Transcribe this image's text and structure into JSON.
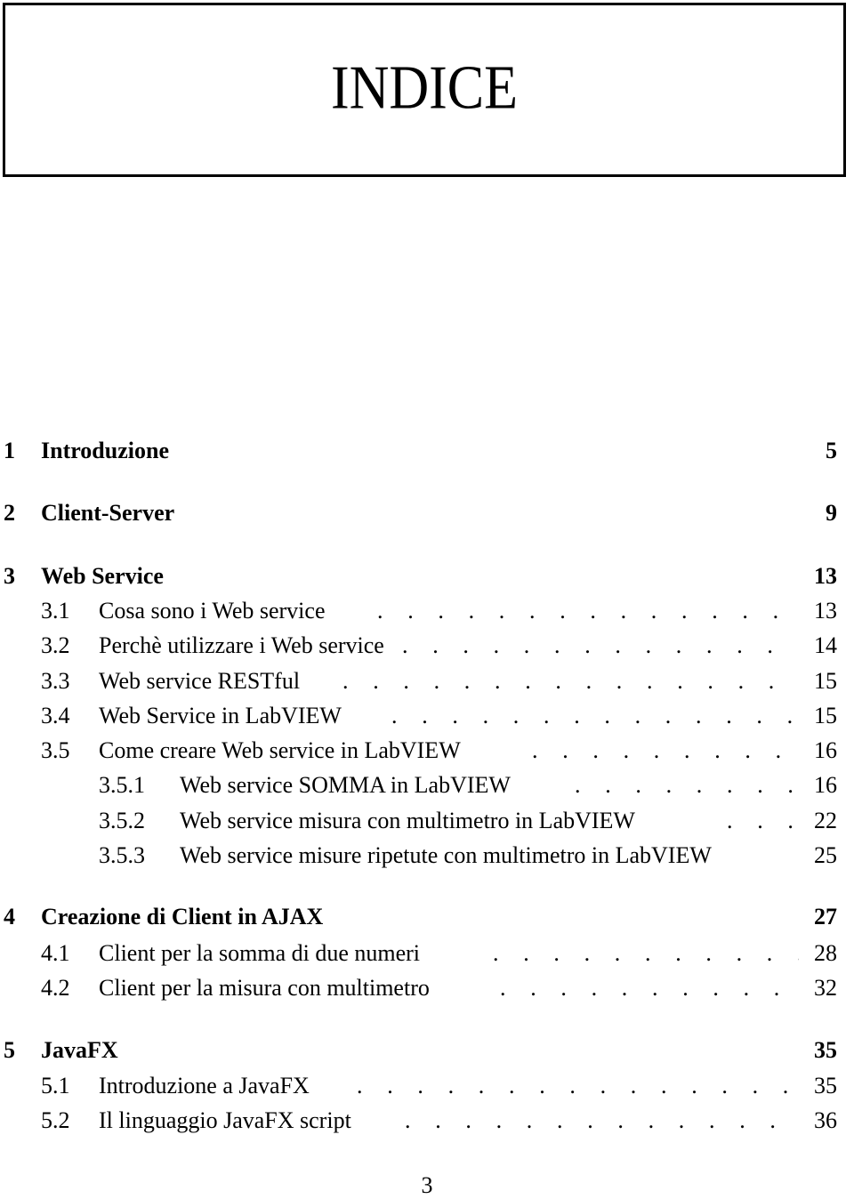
{
  "header": {
    "title": "INDICE"
  },
  "toc": [
    {
      "level": "chapter",
      "number": "1",
      "title": "Introduzione",
      "page": "5",
      "leader": false
    },
    {
      "level": "chapter",
      "number": "2",
      "title": "Client-Server",
      "page": "9",
      "leader": false
    },
    {
      "level": "chapter",
      "number": "3",
      "title": "Web Service",
      "page": "13",
      "leader": false
    },
    {
      "level": "section",
      "number": "3.1",
      "title": "Cosa sono i Web service",
      "page": "13",
      "leader": true
    },
    {
      "level": "section",
      "number": "3.2",
      "title": "Perchè utilizzare i Web service",
      "page": "14",
      "leader": true
    },
    {
      "level": "section",
      "number": "3.3",
      "title": "Web service RESTful",
      "page": "15",
      "leader": true
    },
    {
      "level": "section",
      "number": "3.4",
      "title": "Web Service in LabVIEW",
      "page": "15",
      "leader": true
    },
    {
      "level": "section",
      "number": "3.5",
      "title": "Come creare Web service in LabVIEW",
      "page": "16",
      "leader": true
    },
    {
      "level": "subsection",
      "number": "3.5.1",
      "title": "Web service SOMMA in LabVIEW",
      "page": "16",
      "leader": true
    },
    {
      "level": "subsection",
      "number": "3.5.2",
      "title": "Web service misura con multimetro in LabVIEW",
      "page": "22",
      "leader": true
    },
    {
      "level": "subsection",
      "number": "3.5.3",
      "title": "Web service misure ripetute con multimetro in LabVIEW",
      "page": "25",
      "leader": false
    },
    {
      "level": "chapter",
      "number": "4",
      "title": "Creazione di Client in AJAX",
      "page": "27",
      "leader": false
    },
    {
      "level": "section",
      "number": "4.1",
      "title": "Client per la somma di due numeri",
      "page": "28",
      "leader": true
    },
    {
      "level": "section",
      "number": "4.2",
      "title": "Client per la misura con multimetro",
      "page": "32",
      "leader": true
    },
    {
      "level": "chapter",
      "number": "5",
      "title": "JavaFX",
      "page": "35",
      "leader": false
    },
    {
      "level": "section",
      "number": "5.1",
      "title": "Introduzione a JavaFX",
      "page": "35",
      "leader": true
    },
    {
      "level": "section",
      "number": "5.2",
      "title": "Il linguaggio JavaFX script",
      "page": "36",
      "leader": true
    }
  ],
  "leader_dots": ". . . . . . . . . . . . . . . . . . . . . . . . . . . . . . . . . . . . . . . .",
  "footer": {
    "page_number": "3"
  }
}
